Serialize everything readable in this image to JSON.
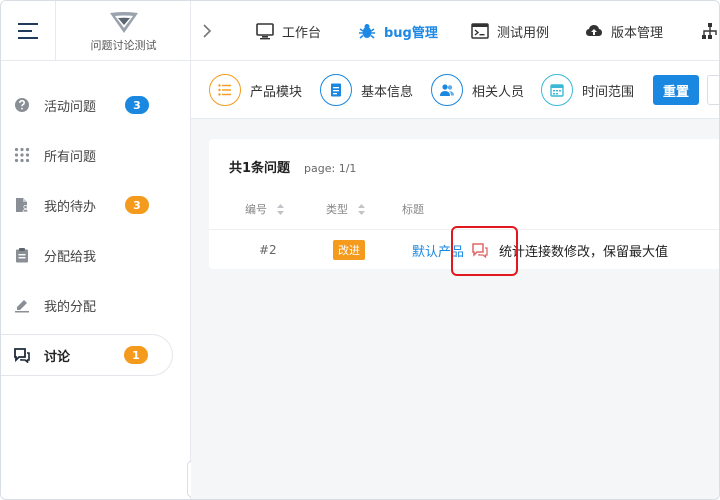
{
  "header": {
    "logo_text": "问题讨论测试",
    "nav": [
      {
        "label": "工作台",
        "icon": "monitor-icon"
      },
      {
        "label": "bug管理",
        "icon": "bug-icon"
      },
      {
        "label": "测试用例",
        "icon": "terminal-icon"
      },
      {
        "label": "版本管理",
        "icon": "cloud-upload-icon"
      }
    ]
  },
  "sidebar": {
    "items": [
      {
        "label": "活动问题",
        "badge": "3",
        "badge_color": "#1a87e0"
      },
      {
        "label": "所有问题",
        "badge": null
      },
      {
        "label": "我的待办",
        "badge": "3",
        "badge_color": "#f49a1c"
      },
      {
        "label": "分配给我",
        "badge": null
      },
      {
        "label": "我的分配",
        "badge": null
      },
      {
        "label": "讨论",
        "badge": "1",
        "badge_color": "#f49a1c"
      }
    ]
  },
  "filters": [
    {
      "label": "产品模块",
      "icon": "list-icon",
      "color": "#f49a1c"
    },
    {
      "label": "基本信息",
      "icon": "document-icon",
      "color": "#1a87e0"
    },
    {
      "label": "相关人员",
      "icon": "people-icon",
      "color": "#1a87e0"
    },
    {
      "label": "时间范围",
      "icon": "calendar-icon",
      "color": "#3bb8d6"
    }
  ],
  "reset_label": "重置",
  "list": {
    "summary": "共1条问题",
    "page": "page:  1/1",
    "columns": [
      "编号",
      "类型",
      "标题"
    ],
    "rows": [
      {
        "id": "#2",
        "type": "改进",
        "product": "默认产品",
        "title": "统计连接数修改，保留最大值"
      }
    ]
  },
  "colors": {
    "accent": "#1a87e0",
    "warning": "#f49a1c",
    "highlight": "#e0191f"
  }
}
